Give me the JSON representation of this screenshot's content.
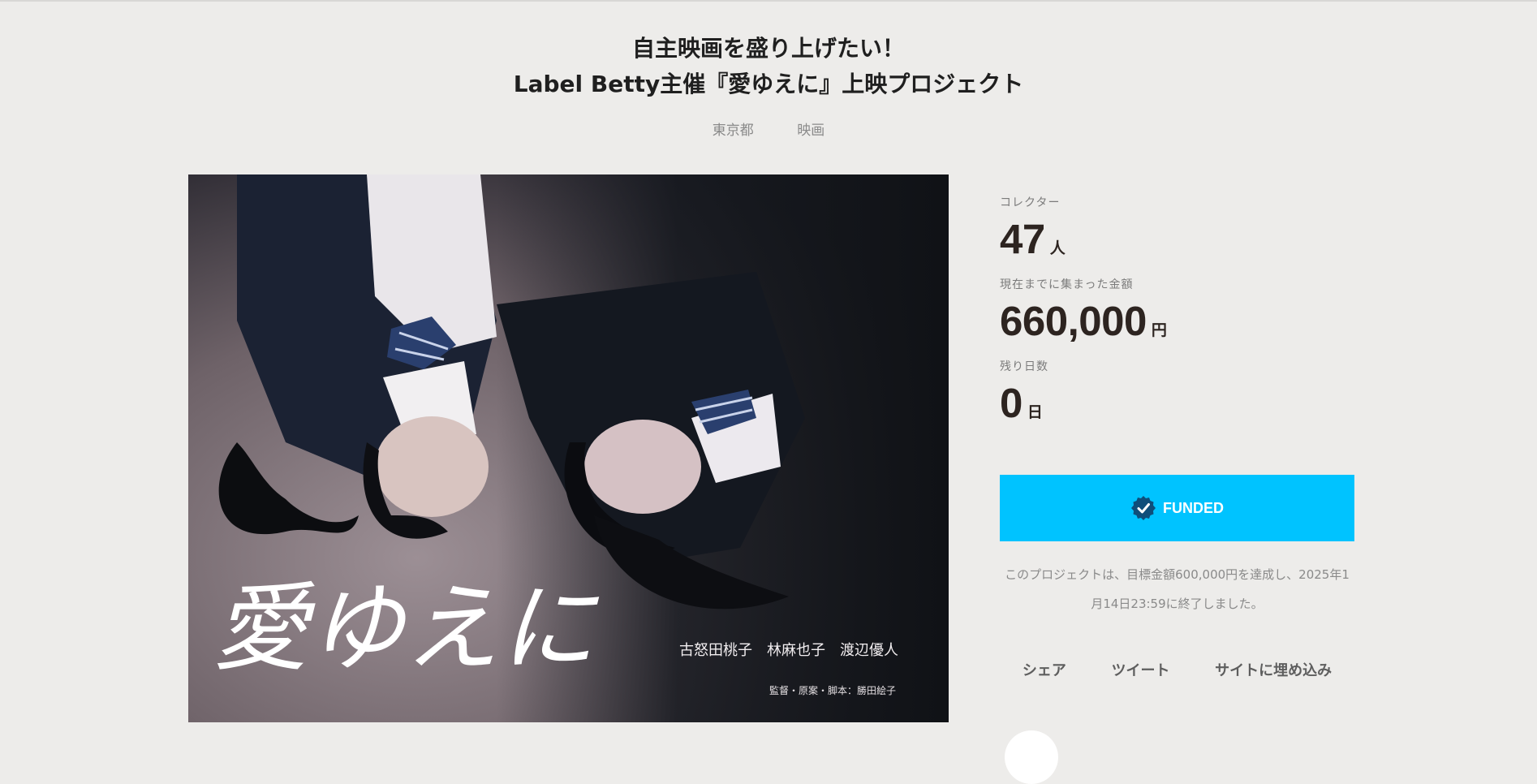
{
  "project": {
    "title_line1": "自主映画を盛り上げたい！",
    "title_line2": "Label Betty主催『愛ゆえに』上映プロジェクト",
    "tags": [
      "東京都",
      "映画"
    ]
  },
  "poster": {
    "title": "愛ゆえに",
    "cast": "古怒田桃子　林麻也子　渡辺優人",
    "credit": "監督・原案・脚本：勝田絵子"
  },
  "stats": {
    "collectors_label": "コレクター",
    "collectors_value": "47",
    "collectors_unit": "人",
    "amount_label": "現在までに集まった金額",
    "amount_value": "660,000",
    "amount_unit": "円",
    "days_label": "残り日数",
    "days_value": "0",
    "days_unit": "日"
  },
  "status": {
    "funded_label": "FUNDED",
    "note_line1": "このプロジェクトは、目標金額600,000円を達成し、2025年1",
    "note_line2": "月14日23:59に終了しました。"
  },
  "share": {
    "share_label": "シェア",
    "tweet_label": "ツイート",
    "embed_label": "サイトに埋め込み"
  },
  "colors": {
    "background": "#edecea",
    "funded_button": "#00c3ff",
    "stat_text": "#2d2420"
  }
}
